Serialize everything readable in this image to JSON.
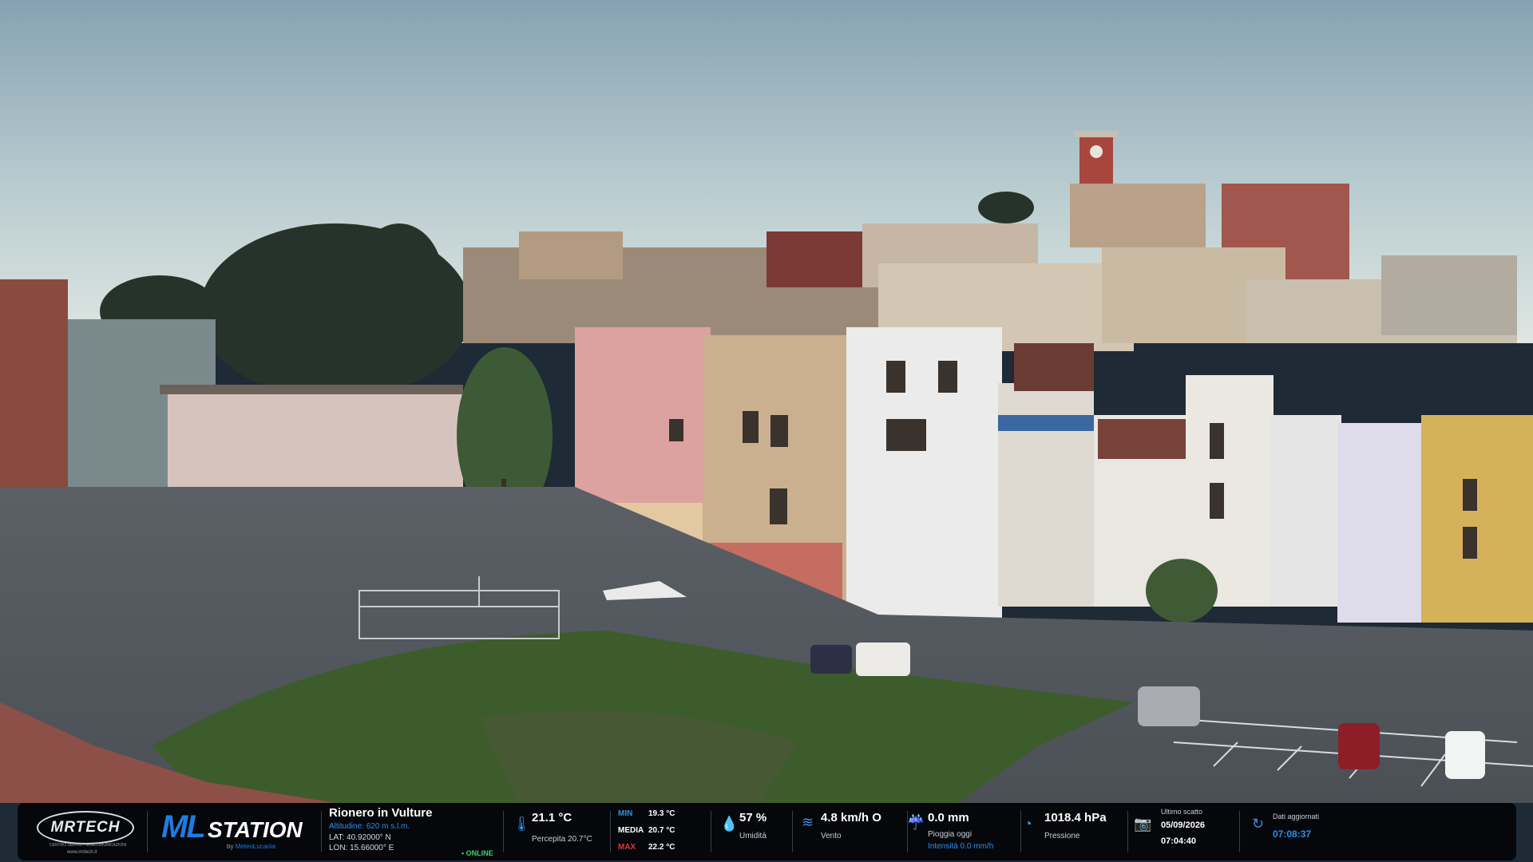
{
  "station": {
    "brand_logo": "MRTECH",
    "brand_tagline": "CENTRO SERVIZI TELECOMUNICAZIONI",
    "brand_site": "www.mrtech.it",
    "product_ml": "ML",
    "product_station": "STATION",
    "product_by_prefix": "by",
    "product_by_name": "MeteoLucania",
    "location_name": "Rionero in Vulture",
    "altitude": "Altitudine: 620 m s.l.m.",
    "lat": "LAT: 40.92000° N",
    "lon": "LON: 15.66000° E",
    "status": "• ONLINE"
  },
  "weather": {
    "temperature": "21.1 °C",
    "feels_like": "Percepita 20.7°C",
    "min_label": "MIN",
    "min_value": "19.3 °C",
    "avg_label": "MEDIA",
    "avg_value": "20.7 °C",
    "max_label": "MAX",
    "max_value": "22.2 °C",
    "humidity": "57 %",
    "humidity_label": "Umidità",
    "wind": "4.8 km/h O",
    "wind_label": "Vento",
    "rain": "0.0 mm",
    "rain_label": "Pioggia oggi",
    "rain_intensity": "Intensità 0.0 mm/h",
    "pressure": "1018.4 hPa",
    "pressure_label": "Pressione",
    "last_shot_label": "Ultimo scatto",
    "last_shot_date": "05/09/2026",
    "last_shot_time": "07:04:40",
    "updated_label": "Dati aggiornati",
    "updated_time": "07:08:37"
  },
  "colors": {
    "sky_top": "#87a3b3",
    "sky_bottom": "#d9e4e2",
    "accent_blue": "#2f8fe8",
    "online_green": "#39d36b",
    "max_red": "#e8323c"
  },
  "icons": [
    "thermometer-icon",
    "drop-icon",
    "wind-icon",
    "rain-icon",
    "gauge-icon",
    "camera-icon",
    "refresh-icon"
  ]
}
